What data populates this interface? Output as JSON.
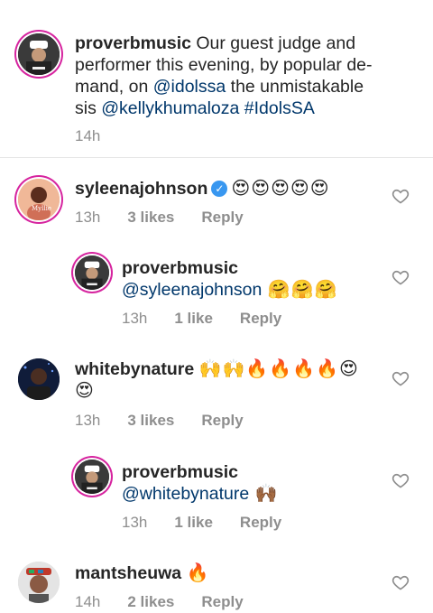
{
  "caption": {
    "username": "proverbmusic",
    "text_before": " Our guest judge and performer this evening, by popular de-mand, on ",
    "mention1": "@idolssa",
    "text_mid": " the unmistakable sis ",
    "mention2": "@kellykhumaloza",
    "text_space": " ",
    "hashtag": "#IdolsSA",
    "time": "14h"
  },
  "comments": [
    {
      "username": "syleenajohnson",
      "verified": true,
      "text": "😍😍😍😍😍",
      "time": "13h",
      "likes": "3 likes",
      "reply": "Reply"
    },
    {
      "username": "proverbmusic",
      "mention": "@syleenajohnson",
      "text": " 🤗🤗🤗",
      "time": "13h",
      "likes": "1 like",
      "reply": "Reply"
    },
    {
      "username": "whitebynature",
      "text": "🙌🙌🔥🔥🔥🔥😍😍",
      "time": "13h",
      "likes": "3 likes",
      "reply": "Reply"
    },
    {
      "username": "proverbmusic",
      "mention": "@whitebynature",
      "text": " 🙌🏾",
      "time": "13h",
      "likes": "1 like",
      "reply": "Reply"
    },
    {
      "username": "mantsheuwa",
      "text": "🔥",
      "time": "14h",
      "likes": "2 likes",
      "reply": "Reply"
    }
  ],
  "icons": {
    "heart": "heart-outline-icon",
    "verified": "verified-badge-icon"
  },
  "colors": {
    "mention": "#00376b",
    "meta": "#8e8e8e",
    "verified": "#3897f0",
    "story_ring": "#d6249f"
  }
}
